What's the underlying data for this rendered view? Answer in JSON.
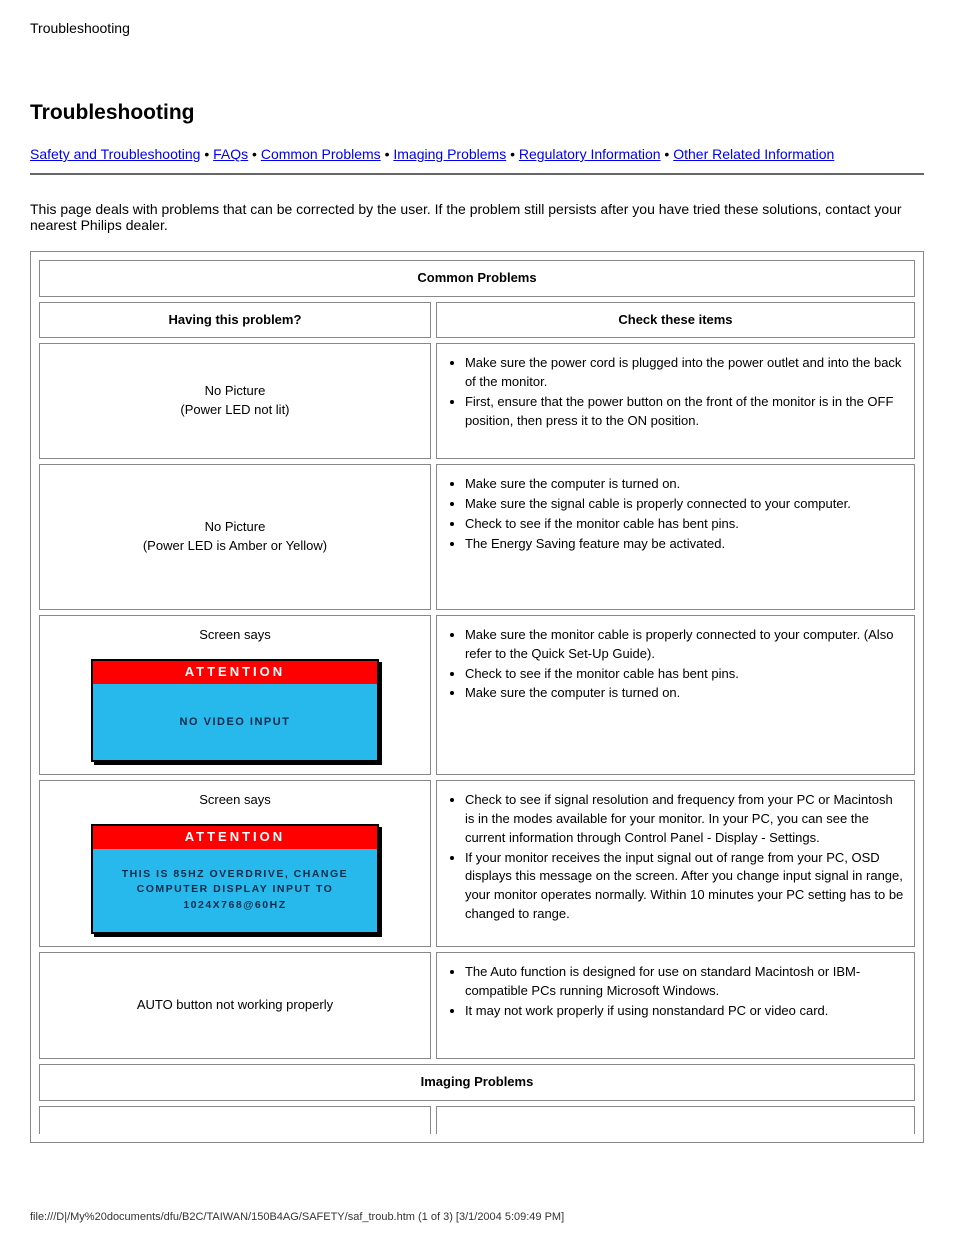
{
  "page_title_1": "Troubleshooting",
  "page_title_2": "Troubleshooting",
  "nav": {
    "items": [
      "Safety and Troubleshooting",
      "FAQs",
      "Common Problems",
      "Imaging Problems",
      "Regulatory Information",
      "Other Related Information"
    ],
    "sep": " • "
  },
  "intro": "This page deals with problems that can be corrected by the user. If the problem still persists after you have tried these solutions, contact your nearest Philips dealer.",
  "table": {
    "header": "Common Problems",
    "col1": "Having this problem?",
    "col2": "Check these items",
    "rows": [
      {
        "problem": "No Picture\n(Power LED not lit)",
        "items": [
          "Make sure the power cord is plugged into the power outlet and into the back of the monitor.",
          "First, ensure that the power button on the front of the monitor is in the OFF position, then press it to the ON position."
        ]
      },
      {
        "problem": "No Picture\n(Power LED is Amber or Yellow)",
        "items": [
          "Make sure the computer is turned on.",
          "Make sure the signal cable is properly connected to your computer.",
          "Check to see if the monitor cable has bent pins.",
          "The Energy Saving feature may be activated."
        ]
      },
      {
        "problem": "Screen says",
        "caption": "",
        "attention": {
          "header": "ATTENTION",
          "body": "NO VIDEO INPUT"
        },
        "items": [
          "Make sure the monitor cable is properly connected to your computer. (Also refer to the Quick Set-Up Guide).",
          "Check to see if the monitor cable has bent pins.",
          "Make sure the computer is turned on."
        ]
      },
      {
        "problem": "Screen says",
        "caption": "",
        "attention": {
          "header": "ATTENTION",
          "body": "THIS IS 85HZ OVERDRIVE, CHANGE COMPUTER DISPLAY INPUT TO 1024X768@60HZ"
        },
        "items": [
          "Check to see if signal resolution and frequency from your PC or Macintosh is in the modes available for your monitor. In your PC, you can see the current information through Control Panel - Display - Settings.",
          "If your monitor receives the input signal out of range from your PC, OSD displays this message on the screen. After you change input signal in range, your monitor operates normally. Within 10 minutes your PC setting has to be changed to range."
        ]
      },
      {
        "problem": "AUTO button not working properly",
        "items": [
          "The Auto function is designed for use on standard Macintosh or IBM-compatible PCs running Microsoft Windows.",
          "It may not work properly if using nonstandard PC or video card."
        ]
      }
    ],
    "header2": "Imaging Problems"
  },
  "footer": "file:///D|/My%20documents/dfu/B2C/TAIWAN/150B4AG/SAFETY/saf_troub.htm (1 of 3) [3/1/2004 5:09:49 PM]"
}
